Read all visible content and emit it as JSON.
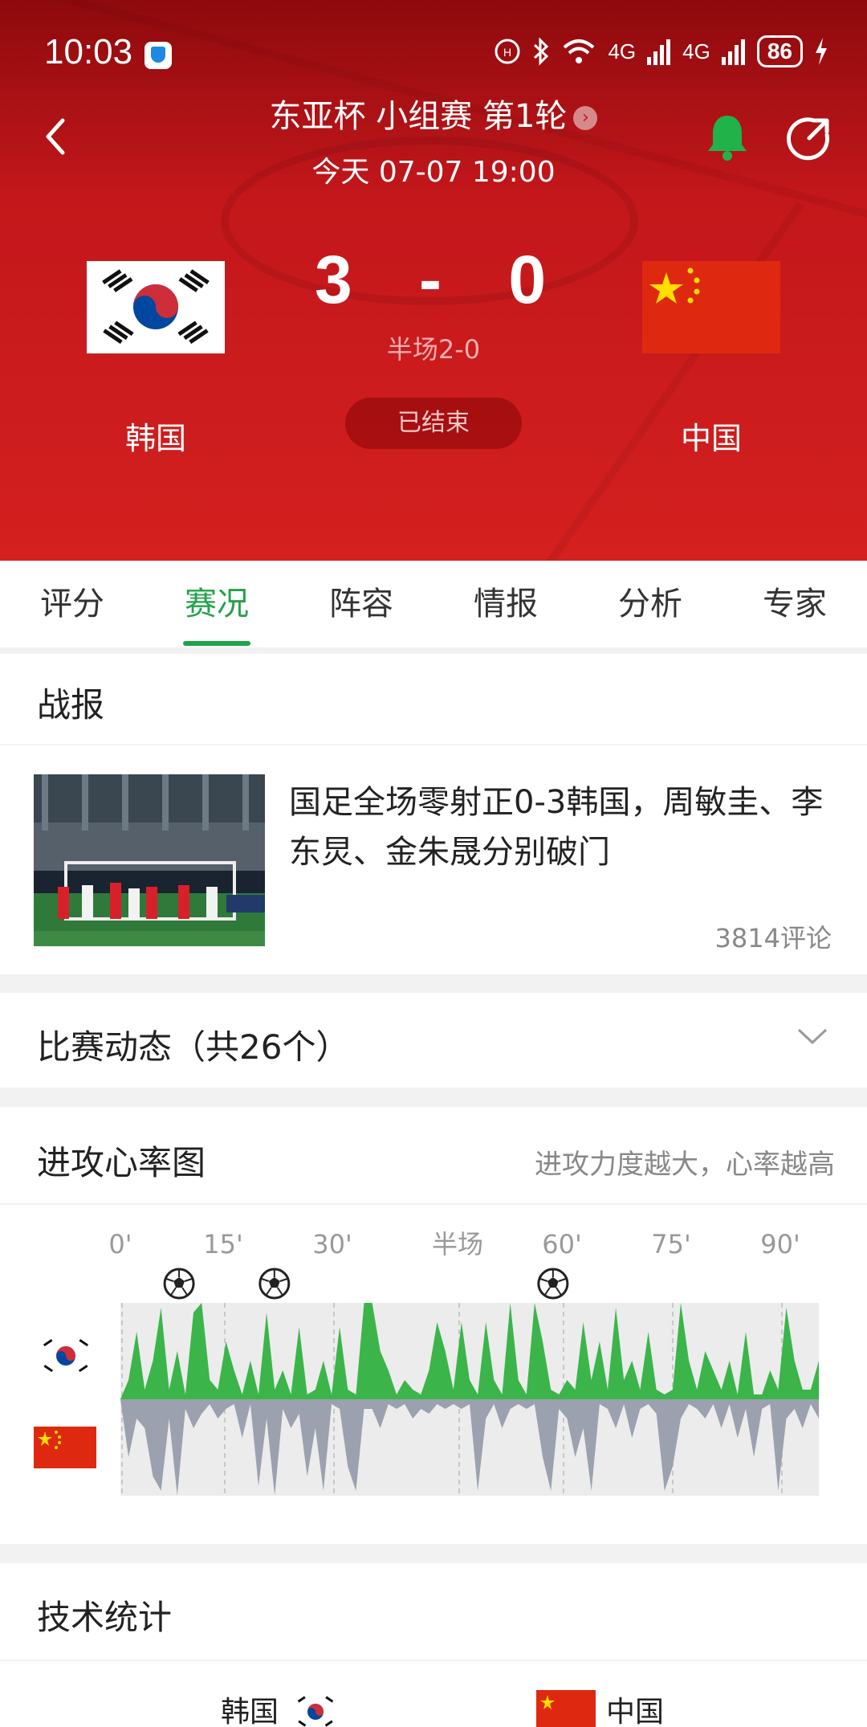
{
  "status_bar": {
    "time": "10:03",
    "network1": "4G",
    "network2": "4G",
    "battery": "86"
  },
  "header": {
    "competition": "东亚杯 小组赛 第1轮",
    "match_time": "今天 07-07 19:00",
    "home_team": "韩国",
    "away_team": "中国",
    "home_score": "3",
    "away_score": "0",
    "score_separator": "-",
    "halftime": "半场2-0",
    "status": "已结束"
  },
  "tabs": [
    "评分",
    "赛况",
    "阵容",
    "情报",
    "分析",
    "专家"
  ],
  "active_tab": "赛况",
  "report": {
    "title": "战报",
    "news_title": "国足全场零射正0-3韩国，周敏圭、李东炅、金朱晟分别破门",
    "comments": "3814评论"
  },
  "events": {
    "title": "比赛动态（共26个）"
  },
  "heart_rate": {
    "title": "进攻心率图",
    "hint": "进攻力度越大，心率越高"
  },
  "chart_data": {
    "type": "area",
    "x_tick_labels": [
      "0'",
      "15'",
      "30'",
      "半场",
      "60'",
      "75'",
      "90'"
    ],
    "goals_home_minutes": [
      8,
      21,
      59
    ],
    "series": [
      {
        "values": [
          0,
          0.2,
          0.7,
          0.1,
          0.4,
          0.95,
          0.1,
          0.5,
          0.05,
          0.9,
          1.0,
          0.2,
          0.1,
          0.6,
          0.3,
          0.05,
          0.4,
          0.05,
          0.9,
          0.1,
          0.3,
          0.05,
          0.75,
          0.05,
          0.1,
          0.4,
          0.05,
          0.75,
          0.1,
          0.05,
          1.0,
          1.0,
          0.5,
          0.3,
          0.05,
          0.2,
          0.1,
          0.05,
          0.3,
          0.8,
          0.5,
          0.1,
          0.8,
          0.2,
          0.05,
          0.8,
          0.2,
          0.05,
          1.0,
          0.2,
          0.05,
          1.0,
          0.6,
          0.1,
          0.05,
          0.2,
          0.1,
          0.8,
          0.2,
          0.6,
          0.1,
          0.95,
          0.2,
          0.4,
          0.1,
          0.7,
          0.1,
          0.05,
          0.1,
          1.0,
          0.4,
          0.1,
          0.5,
          0.3,
          0.1,
          0.4,
          0.05,
          0.7,
          0.05,
          0.05,
          0.3,
          0.1,
          0.95,
          0.4,
          0.1,
          0.1,
          0.4
        ]
      },
      {
        "values": [
          0,
          0.6,
          0.2,
          0.3,
          0.8,
          0.95,
          0.2,
          1.0,
          0.1,
          0.3,
          0.15,
          0.05,
          0.2,
          0.1,
          0.05,
          0.4,
          0.05,
          0.9,
          0.2,
          1.0,
          0.1,
          0.3,
          0.15,
          0.8,
          0.3,
          0.95,
          0.05,
          0.1,
          0.7,
          0.95,
          0.1,
          0.1,
          0.3,
          0.05,
          0.1,
          0.05,
          0.2,
          0.1,
          0.15,
          0.05,
          0.1,
          0.05,
          0.1,
          0.05,
          0.95,
          0.2,
          0.05,
          0.3,
          0.1,
          0.05,
          0.1,
          0.05,
          0.6,
          0.95,
          0.1,
          0.2,
          0.6,
          0.3,
          0.95,
          0.05,
          0.1,
          0.3,
          0.05,
          0.4,
          0.1,
          0.05,
          0.15,
          0.95,
          0.7,
          0.2,
          0.05,
          0.1,
          0.2,
          0.05,
          0.3,
          0.05,
          0.4,
          0.1,
          0.6,
          0.1,
          0.05,
          0.95,
          0.2,
          0.1,
          0.3,
          0.05,
          0.2
        ]
      }
    ]
  },
  "stats": {
    "title": "技术统计",
    "home_team": "韩国",
    "away_team": "中国"
  },
  "colors": {
    "header_red": "#c3171b",
    "accent_green": "#22a24a",
    "home_series": "#3bb54a",
    "away_series": "#9ba1ae"
  }
}
